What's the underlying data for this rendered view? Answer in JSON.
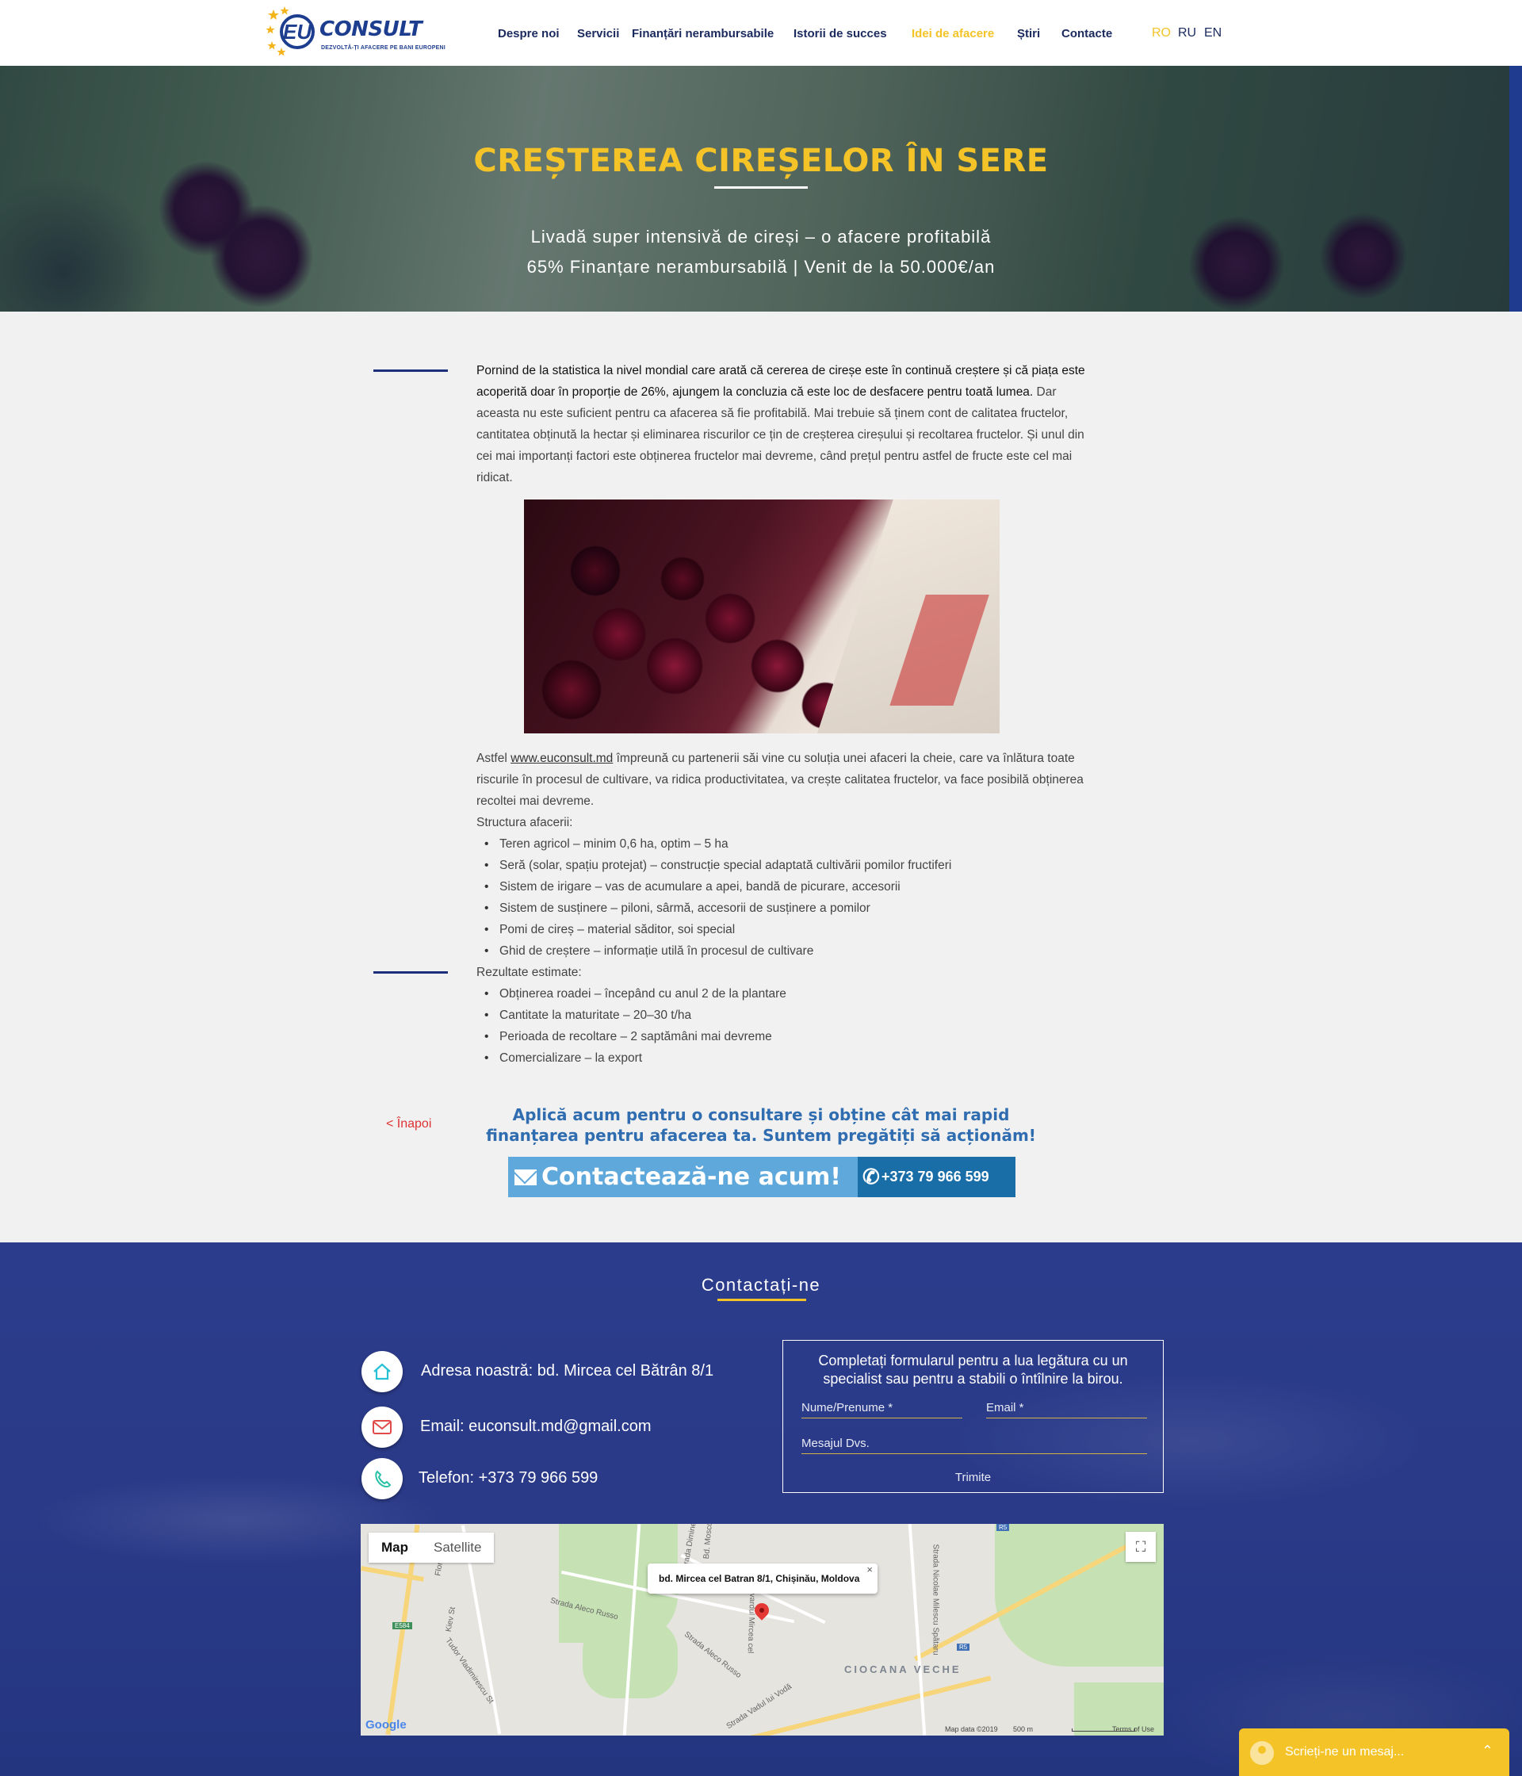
{
  "header": {
    "logo": {
      "brand": "EU CONSULT",
      "mark": "EU",
      "text": "CONSULT",
      "tagline": "DEZVOLTĂ-ȚI AFACERE PE BANI EUROPENI"
    },
    "nav": [
      {
        "label": "Despre noi"
      },
      {
        "label": "Servicii"
      },
      {
        "label": "Finanțări nerambursabile"
      },
      {
        "label": "Istorii de succes"
      },
      {
        "label": "Idei de afacere",
        "active": true
      },
      {
        "label": "Știri"
      },
      {
        "label": "Contacte"
      }
    ],
    "languages": [
      {
        "label": "RO",
        "active": true
      },
      {
        "label": "RU"
      },
      {
        "label": "EN"
      }
    ]
  },
  "hero": {
    "title": "CREȘTEREA CIREȘELOR ÎN SERE",
    "subtitle_1": "Livadă super intensivă de cireși – o afacere profitabilă",
    "subtitle_2": "65% Finanțare nerambursabilă | Venit de la 50.000€/an"
  },
  "article": {
    "intro_bold": "Pornind de la statistica la nivel mondial care arată că cererea de cireșe este în continuă creștere și că piața este acoperită doar în proporție de 26%, ajungem la concluzia că este loc de desfacere pentru toată lumea.",
    "intro_rest": " Dar aceasta nu este suficient pentru ca afacerea să fie profitabilă. Mai trebuie să ținem cont de calitatea fructelor, cantitatea obținută la hectar și eliminarea riscurilor ce țin de creșterea cireșului și recoltarea fructelor. Și unul din cei mai importanți factori este obținerea fructelor mai devreme, când prețul pentru astfel de fructe este cel mai ridicat.",
    "para2_prefix": "Astfel ",
    "para2_link": "www.euconsult.md",
    "para2_rest": " împreună cu partenerii săi vine cu soluția unei afaceri la cheie, care va înlătura toate riscurile în procesul de cultivare, va ridica productivitatea, va crește calitatea fructelor, va face posibilă obținerea recoltei mai devreme.",
    "structure_heading": "Structura afacerii:",
    "structure_items": [
      "Teren agricol – minim 0,6 ha, optim – 5 ha",
      "Seră (solar, spațiu protejat) – construcție special adaptată cultivării pomilor fructiferi",
      "Sistem de irigare – vas de acumulare a apei, bandă de picurare, accesorii",
      "Sistem de susținere – piloni, sârmă, accesorii de susținere a pomilor",
      "Pomi de cireș – material săditor, soi special",
      "Ghid de creștere – informație utilă în procesul de cultivare"
    ],
    "results_heading": "Rezultate estimate:",
    "results_items": [
      "Obținerea roadei – începând cu anul 2 de la plantare",
      "Cantitate la maturitate – 20–30 t/ha",
      "Perioada de recoltare – 2 saptămâni mai devreme",
      "Comercializare – la export"
    ]
  },
  "cta": {
    "back": "< Înapoi",
    "text_1": "Aplică acum pentru o consultare și obține cât mai rapid",
    "text_2": "finanțarea pentru afacerea ta. Suntem pregătiți să acționăm!",
    "contact_button": "Contactează-ne acum!",
    "phone_button": "+373 79 966 599"
  },
  "footer": {
    "title": "Contactați-ne",
    "address": "Adresa noastră: bd. Mircea cel Bătrân 8/1",
    "email": "Email: euconsult.md@gmail.com",
    "phone": "Telefon: +373 79 966 599",
    "form": {
      "heading_1": "Completați formularul pentru a lua legătura cu un",
      "heading_2": "specialist sau pentru a stabili o întîlnire la birou.",
      "name_placeholder": "Nume/Prenume *",
      "email_placeholder": "Email *",
      "message_placeholder": "Mesajul Dvs.",
      "submit": "Trimite"
    }
  },
  "map": {
    "type_map": "Map",
    "type_satellite": "Satellite",
    "popup": "bd. Mircea cel Batran 8/1, Chișinău, Moldova",
    "popup_close": "×",
    "district": "CIOCANA VECHE",
    "streets": [
      "Strada Aleco Russo",
      "Strada Aleco Russo",
      "Bulevardul Mircea cel",
      "Strada Vadul lui Vodă",
      "Strada Nicolae Milescu Spătaru",
      "Florilor",
      "Kiev St",
      "Tudor Vladimirescu St",
      "Strada Dimineții",
      "Bd. Moscova"
    ],
    "road_badges": [
      "E584",
      "R5",
      "R5"
    ],
    "google": "Google",
    "map_data": "Map data ©2019",
    "scale": "500 m",
    "terms": "Terms of Use"
  },
  "chat": {
    "placeholder": "Scrieți-ne un mesaj..."
  },
  "colors": {
    "accent_yellow": "#f4c327",
    "navy": "#1b2a5e",
    "footer_blue": "#2a3a88",
    "cta_blue": "#5fa8db",
    "cta_dark": "#1a6ea8",
    "back_red": "#dd3333"
  },
  "icons": [
    "home-icon",
    "mail-icon",
    "phone-icon",
    "envelope-icon",
    "fullscreen-icon",
    "map-pin-icon",
    "chat-avatar-icon",
    "chevron-up-icon"
  ]
}
